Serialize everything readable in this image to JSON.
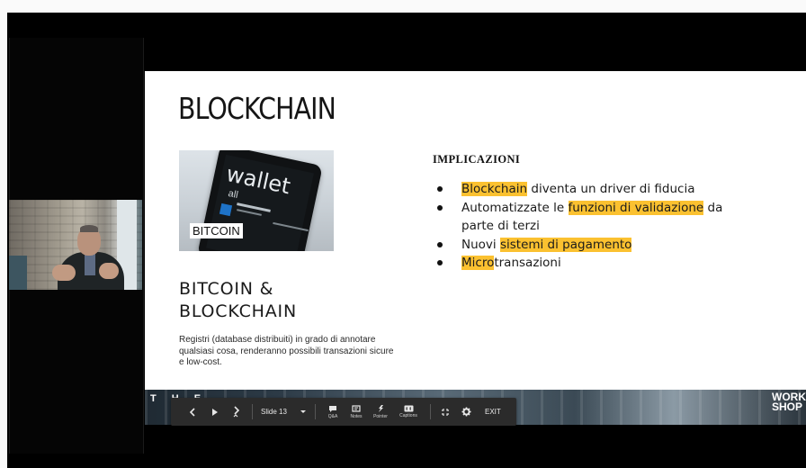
{
  "slide": {
    "title": "BLOCKCHAIN",
    "image_caption": "BITCOIN",
    "image_wallet_word": "wallet",
    "image_wallet_sub": "all",
    "subtitle_line1": "BITCOIN &",
    "subtitle_line2": "BLOCKCHAIN",
    "description": "Registri (database distribuiti) in grado di annotare qualsiasi cosa, renderanno possibili transazioni sicure e low-cost.",
    "implications_heading": "IMPLICAZIONI",
    "bullets": [
      {
        "hl": "Blockchain",
        "rest": " diventa un driver di fiducia"
      },
      {
        "pre": "Automatizzate le ",
        "hl": "funzioni di validazione",
        "rest": " da parte di terzi"
      },
      {
        "pre": "Nuovi ",
        "hl": "sistemi di pagamento"
      },
      {
        "hl": "Micro",
        "rest": "transazioni"
      }
    ],
    "banner_left": "T H E",
    "banner_right_line1": "WORK",
    "banner_right_line2": "SHOP"
  },
  "toolbar": {
    "prev_icon": "chevron-left-icon",
    "play_icon": "play-icon",
    "next_icon": "chevron-right-icon",
    "slide_label": "Slide 13",
    "qa_label": "Q&A",
    "notes_label": "Notes",
    "pointer_label": "Pointer",
    "captions_label": "Captions",
    "exit_label": "EXIT"
  },
  "colors": {
    "highlight": "#fbc130",
    "toolbar_bg": "#2b2b2b",
    "frame_bg": "#000000"
  }
}
